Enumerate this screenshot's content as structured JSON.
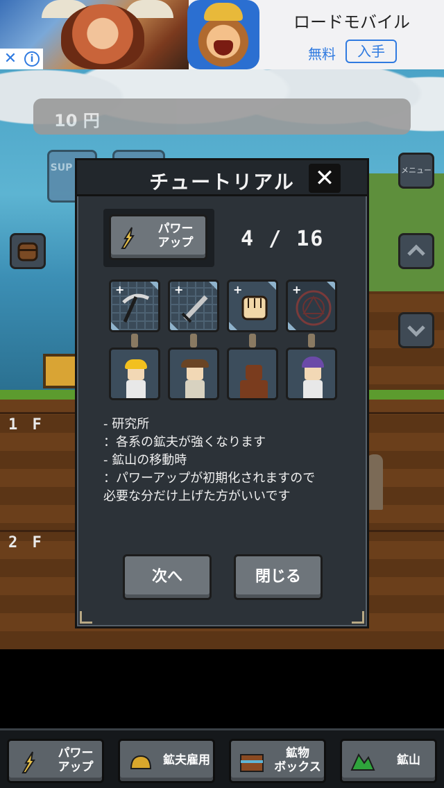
{
  "ad": {
    "title": "ロードモバイル",
    "price": "無料",
    "get_label": "入手",
    "close_glyph": "✕",
    "info_glyph": "i"
  },
  "hud": {
    "money": "10 円",
    "chip_label": "SUP SKI",
    "menu_label": "メニュー"
  },
  "floors": [
    "1 F",
    "2 F"
  ],
  "tutorial": {
    "title": "チュートリアル",
    "close_glyph": "✕",
    "power_label_line1": "パワー",
    "power_label_line2": "アップ",
    "progress": "4 / 16",
    "upgrades": [
      {
        "icon": "pickaxe-icon",
        "plus": "+"
      },
      {
        "icon": "sword-icon",
        "plus": "+"
      },
      {
        "icon": "fist-icon",
        "plus": "+"
      },
      {
        "icon": "magic-circle-icon",
        "plus": "+"
      }
    ],
    "miners": [
      {
        "icon": "miner-yellow-helmet-icon"
      },
      {
        "icon": "miner-explorer-icon"
      },
      {
        "icon": "miner-scarecrow-icon"
      },
      {
        "icon": "miner-wizard-icon"
      }
    ],
    "description": [
      "- 研究所",
      "：各系の鉱夫が強くなります",
      "- 鉱山の移動時",
      "：パワーアップが初期化されますので",
      "必要な分だけ上げた方がいいです"
    ],
    "next_label": "次へ",
    "close_label": "閉じる"
  },
  "nav": {
    "power_up_line1": "パワー",
    "power_up_line2": "アップ",
    "hire_label": "鉱夫雇用",
    "ore_box_line1": "鉱物",
    "ore_box_line2": "ボックス",
    "mine_label": "鉱山"
  },
  "colors": {
    "modal_bg": "#2c3238",
    "button_gray": "#6e757b",
    "ad_blue": "#2f7ae0"
  }
}
